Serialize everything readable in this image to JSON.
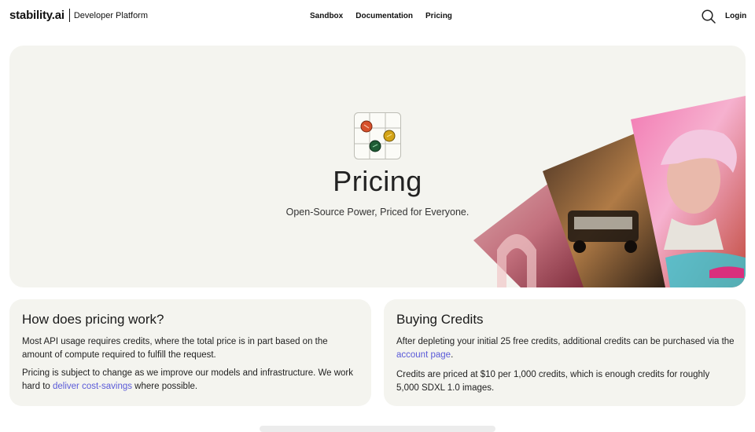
{
  "header": {
    "logo_text": "stability.ai",
    "logo_sub": "Developer Platform",
    "nav": [
      {
        "label": "Sandbox"
      },
      {
        "label": "Documentation"
      },
      {
        "label": "Pricing"
      }
    ],
    "search_icon": "search-icon",
    "login_label": "Login"
  },
  "hero": {
    "icon": "pricing-grid-icon",
    "title": "Pricing",
    "subtitle": "Open-Source Power, Priced for Everyone.",
    "colors": {
      "background": "#f4f4ef",
      "dot_red": "#d6502b",
      "dot_yellow": "#d4a417",
      "dot_green": "#1f5c35"
    }
  },
  "cards": {
    "how": {
      "title": "How does pricing work?",
      "p1": "Most API usage requires credits, where the total price is in part based on the amount of compute required to fulfill the request.",
      "p2_before": "Pricing is subject to change as we improve our models and infrastructure. We work hard to ",
      "p2_link": "deliver cost-savings",
      "p2_after": " where possible."
    },
    "buying": {
      "title": "Buying Credits",
      "p1_before": "After depleting your initial 25 free credits, additional credits can be purchased via the ",
      "p1_link": "account page",
      "p1_after": ".",
      "p2": "Credits are priced at $10 per 1,000 credits, which is enough credits for roughly 5,000 SDXL 1.0 images."
    }
  },
  "colors": {
    "link": "#5a5ad8",
    "card_bg": "#f4f4ef"
  }
}
